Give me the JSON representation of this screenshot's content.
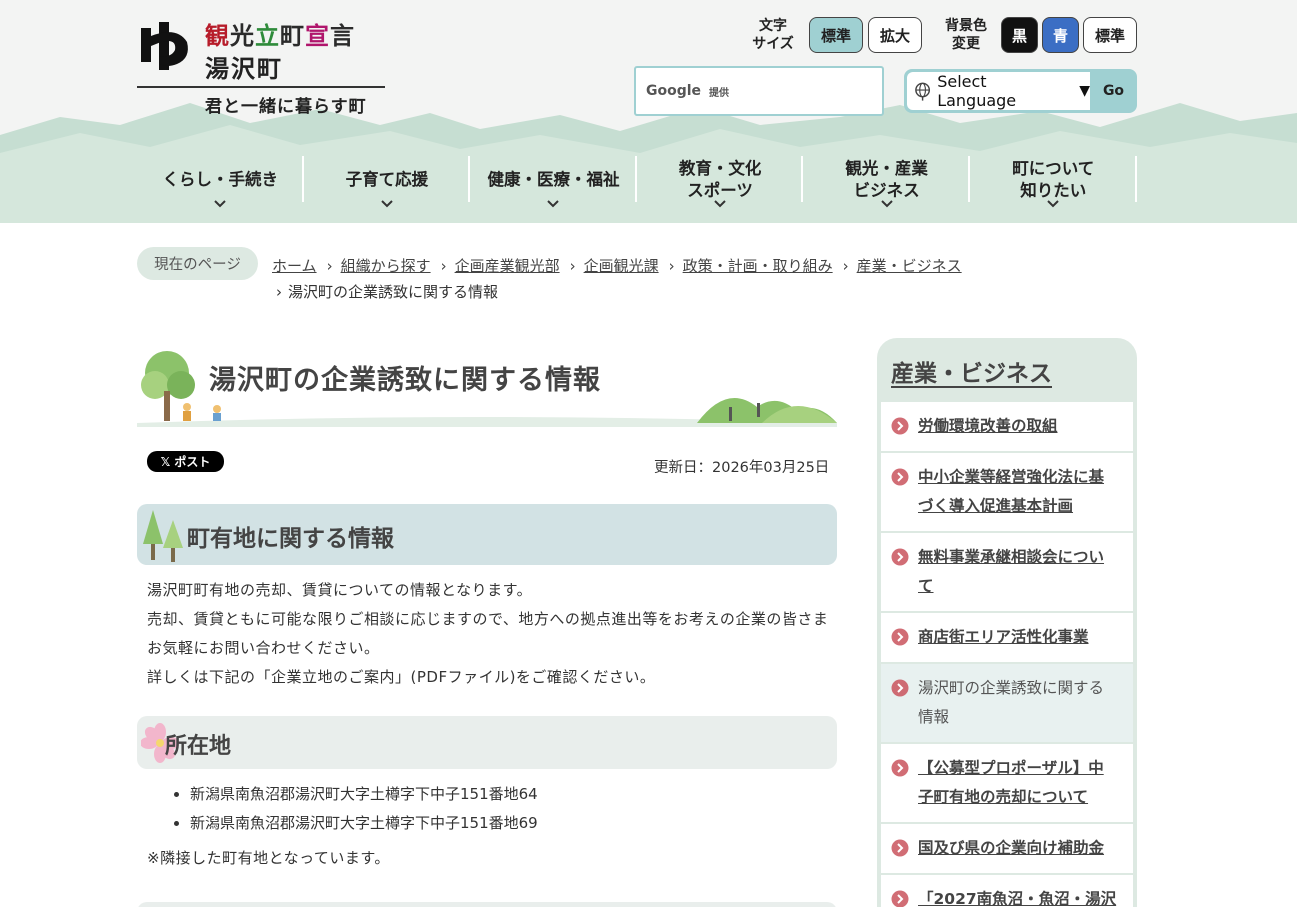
{
  "header": {
    "logo": {
      "slogan_chars": [
        {
          "c": "観",
          "color": "#b71c2a"
        },
        {
          "c": "光",
          "color": "#2b2b2b"
        },
        {
          "c": "立",
          "color": "#2e8b3a"
        },
        {
          "c": "町",
          "color": "#2b2b2b"
        },
        {
          "c": "宣",
          "color": "#b0156c"
        },
        {
          "c": "言",
          "color": "#2b2b2b"
        }
      ],
      "name": "湯沢町",
      "tagline": "君と一緒に暮らす町"
    },
    "text_size": {
      "label": "文字\nサイズ",
      "standard": "標準",
      "large": "拡大"
    },
    "bg_color": {
      "label": "背景色\n変更",
      "black": "黒",
      "blue": "青",
      "standard": "標準"
    },
    "search": {
      "google": "Google",
      "provided": "提供"
    },
    "language": {
      "select_label": "Select Language",
      "go": "Go"
    },
    "nav": [
      {
        "line1": "くらし・手続き",
        "line2": ""
      },
      {
        "line1": "子育て応援",
        "line2": ""
      },
      {
        "line1": "健康・医療・福祉",
        "line2": ""
      },
      {
        "line1": "教育・文化",
        "line2": "スポーツ"
      },
      {
        "line1": "観光・産業",
        "line2": "ビジネス"
      },
      {
        "line1": "町について",
        "line2": "知りたい"
      }
    ]
  },
  "breadcrumb": {
    "label": "現在のページ",
    "links": [
      "ホーム",
      "組織から探す",
      "企画産業観光部",
      "企画観光課",
      "政策・計画・取り組み",
      "産業・ビジネス"
    ],
    "current": "湯沢町の企業誘致に関する情報"
  },
  "main": {
    "title": "湯沢町の企業誘致に関する情報",
    "post_button": "ポスト",
    "updated": "更新日：2026年03月25日",
    "section1": {
      "heading": "町有地に関する情報",
      "paragraphs": [
        "湯沢町町有地の売却、賃貸についての情報となります。",
        "売却、賃貸ともに可能な限りご相談に応じますので、地方への拠点進出等をお考えの企業の皆さまお気軽にお問い合わせください。",
        "詳しくは下記の「企業立地のご案内」(PDFファイル)をご確認ください。"
      ]
    },
    "section2": {
      "heading": "所在地",
      "addresses": [
        "新潟県南魚沼郡湯沢町大字土樽字下中子151番地64",
        "新潟県南魚沼郡湯沢町大字土樽字下中子151番地69"
      ],
      "note": "※隣接した町有地となっています。"
    }
  },
  "side": {
    "title": "産業・ビジネス",
    "items": [
      {
        "label": "労働環境改善の取組",
        "current": false
      },
      {
        "label": "中小企業等経営強化法に基づく導入促進基本計画",
        "current": false
      },
      {
        "label": "無料事業承継相談会について",
        "current": false
      },
      {
        "label": "商店街エリア活性化事業",
        "current": false
      },
      {
        "label": "湯沢町の企業誘致に関する情報",
        "current": true
      },
      {
        "label": "【公募型プロポーザル】中子町有地の売却について",
        "current": false
      },
      {
        "label": "国及び県の企業向け補助金",
        "current": false
      },
      {
        "label": "「2027南魚沼・魚沼・湯沢",
        "current": false
      }
    ]
  },
  "colors": {
    "accent_teal": "#9fd0d2",
    "heading_bg": "#d2e2e4",
    "side_bg": "#dde9e2",
    "arrow_red": "#c9535d"
  },
  "icons": {
    "logo_mark": "town-emblem-icon",
    "globe": "globe-icon",
    "nav_chevron": "chevron-down-icon",
    "side_arrow": "circle-arrow-right-icon",
    "x_logo": "x-logo-icon",
    "trees": "trees-icon",
    "flower": "flower-icon"
  }
}
